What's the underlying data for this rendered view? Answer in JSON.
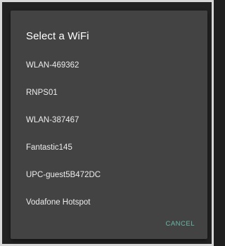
{
  "dialog": {
    "title": "Select a WiFi",
    "networks": [
      {
        "label": "WLAN-469362"
      },
      {
        "label": "RNPS01"
      },
      {
        "label": "WLAN-387467"
      },
      {
        "label": "Fantastic145"
      },
      {
        "label": "UPC-guest5B472DC"
      },
      {
        "label": "Vodafone Hotspot"
      }
    ],
    "cancel_label": "CANCEL"
  },
  "colors": {
    "dialog_background": "#434343",
    "accent": "#69b8a6",
    "text": "#ececec"
  }
}
